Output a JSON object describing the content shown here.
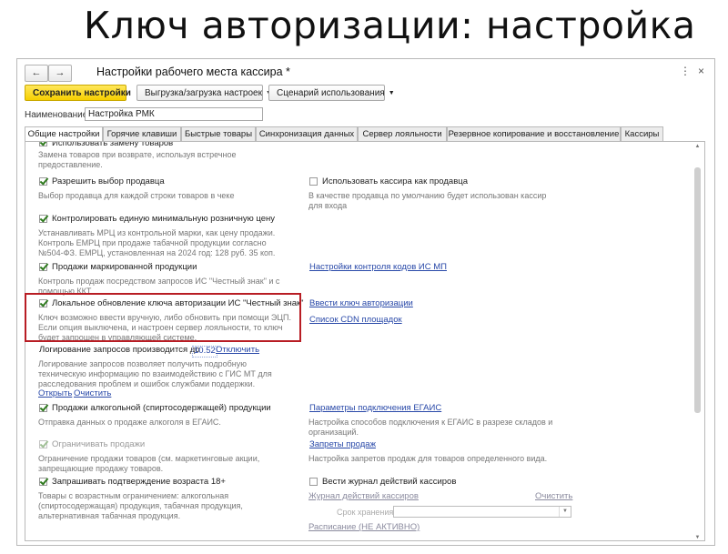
{
  "slide": {
    "title": "Ключ авторизации: настройка"
  },
  "window": {
    "title": "Настройки рабочего места кассира *",
    "back_glyph": "←",
    "forward_glyph": "→",
    "more_glyph": "⋮",
    "close_glyph": "×"
  },
  "toolbar": {
    "save_label": "Сохранить настройки",
    "export_label": "Выгрузка/загрузка настроек",
    "scenario_label": "Сценарий использования"
  },
  "name_field": {
    "label": "Наименование:",
    "value": "Настройка РМК"
  },
  "tabs": [
    {
      "label": "Общие настройки",
      "active": true
    },
    {
      "label": "Горячие клавиши"
    },
    {
      "label": "Быстрые товары"
    },
    {
      "label": "Синхронизация данных"
    },
    {
      "label": "Сервер лояльности"
    },
    {
      "label": "Резервное копирование и восстановление"
    },
    {
      "label": "Кассиры"
    }
  ],
  "settings": {
    "replace": {
      "label": "Использовать замену товаров",
      "desc1": "Замена товаров при возврате, используя встречное",
      "desc2": "предоставление."
    },
    "seller_choice": {
      "label": "Разрешить выбор продавца",
      "checked": true,
      "desc": "Выбор продавца для каждой строки товаров в чеке"
    },
    "cashier_as_seller": {
      "label": "Использовать кассира как продавца",
      "checked": false,
      "desc1": "В качестве продавца по умолчанию будет использован кассир",
      "desc2": "для входа"
    },
    "mrc": {
      "label": "Контролировать единую минимальную розничную цену",
      "checked": true,
      "desc1": "Устанавливать МРЦ из контрольной марки, как цену продажи.",
      "desc2": "Контроль ЕМРЦ при продаже табачной продукции согласно",
      "desc3": "№504-ФЗ. ЕМРЦ, установленная на 2024 год: 128 руб. 35 коп."
    },
    "marked": {
      "label": "Продажи маркированной продукции",
      "checked": true,
      "desc1": "Контроль продаж посредством запросов ИС \"Честный знак\" и с",
      "desc2": "помощью ККТ.",
      "link": "Настройки контроля кодов ИС МП"
    },
    "auth_key": {
      "label": "Локальное обновление ключа авторизации ИС \"Честный знак\"",
      "checked": true,
      "desc1": "Ключ возможно ввести вручную, либо обновить при помощи ЭЦП.",
      "desc2": "Если опция выключена, и настроен сервер лояльности, то ключ",
      "desc3": "будет запрошен в управляющей системе.",
      "link1": "Ввести ключ авторизации",
      "link2": "Список CDN площадок"
    },
    "logging": {
      "label": "Логирование запросов производится до",
      "value": "10.52",
      "disable_link": "Отключить",
      "desc1": "Логирование запросов позволяет получить подробную",
      "desc2": "техническую информацию по взаимодействию с ГИС МТ для",
      "desc3": "расследования проблем и ошибок службами поддержки.",
      "open_link": "Открыть",
      "clear_link": "Очистить"
    },
    "alcohol": {
      "label": "Продажи алкогольной (спиртосодержащей) продукции",
      "checked": true,
      "desc": "Отправка данных о продаже алкоголя в ЕГАИС.",
      "link": "Параметры подключения ЕГАИС",
      "link_desc1": "Настройка способов подключения к ЕГАИС в разрезе складов и",
      "link_desc2": "организаций."
    },
    "restrict": {
      "label": "Ограничивать продажи",
      "checked": true,
      "disabled": true,
      "desc1": "Ограничение продажи товаров (см. маркетинговые акции,",
      "desc2": "запрещающие продажу товаров.",
      "link": "Запреты продаж",
      "link_desc": "Настройка запретов продаж для товаров определенного вида."
    },
    "age": {
      "label": "Запрашивать подтверждение возраста 18+",
      "checked": true,
      "desc1": "Товары с возрастным ограничением: алкогольная",
      "desc2": "(спиртосодержащая) продукция, табачная продукция,",
      "desc3": "альтернативная табачная продукция."
    },
    "journal": {
      "label": "Вести журнал действий кассиров",
      "checked": false,
      "link": "Журнал действий кассиров",
      "clear_link": "Очистить",
      "storage_label": "Срок хранения:",
      "schedule_link": "Расписание (НЕ АКТИВНО)"
    }
  }
}
